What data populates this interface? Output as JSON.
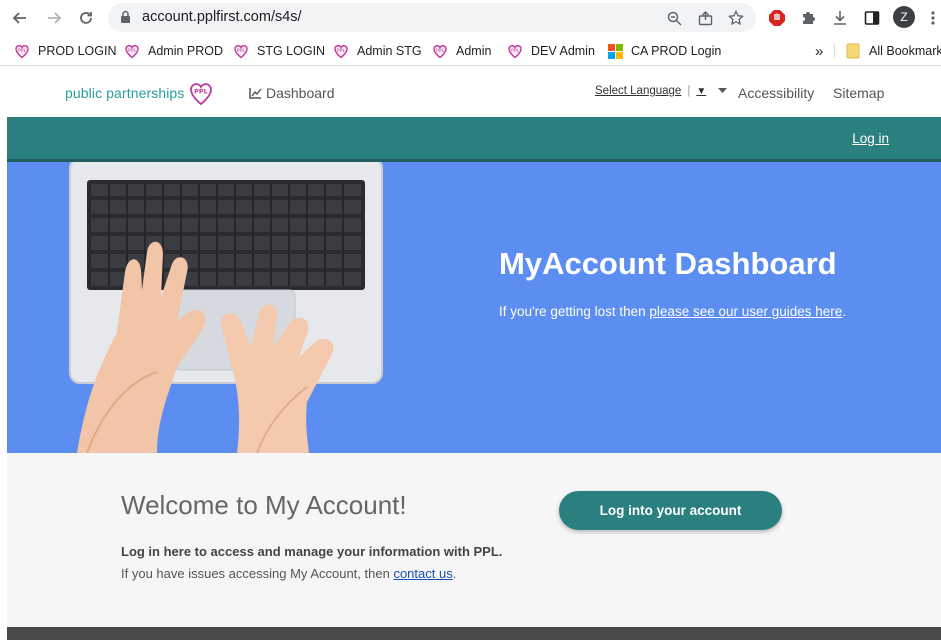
{
  "browser": {
    "url": "account.pplfirst.com/s4s/",
    "avatar_letter": "Z",
    "bookmarks": [
      {
        "label": "PROD LOGIN",
        "icon": "ppl-heart-icon"
      },
      {
        "label": "Admin PROD",
        "icon": "ppl-heart-icon"
      },
      {
        "label": "STG LOGIN",
        "icon": "ppl-heart-icon"
      },
      {
        "label": "Admin STG",
        "icon": "ppl-heart-icon"
      },
      {
        "label": "Admin",
        "icon": "ppl-heart-icon"
      },
      {
        "label": "DEV Admin",
        "icon": "ppl-heart-icon"
      },
      {
        "label": "CA PROD Login",
        "icon": "microsoft-icon"
      }
    ],
    "overflow_label": "»",
    "all_bookmarks_label": "All Bookmarks"
  },
  "header": {
    "logo_text": "public partnerships",
    "logo_badge": "PPL",
    "dashboard_label": "Dashboard",
    "language_label": "Select Language",
    "language_arrow": "▼",
    "accessibility_label": "Accessibility",
    "sitemap_label": "Sitemap"
  },
  "topbar": {
    "login_label": "Log in"
  },
  "hero": {
    "title": "MyAccount Dashboard",
    "sub_prefix": "If you're getting lost then ",
    "sub_link": "please see our user guides here",
    "sub_suffix": "."
  },
  "welcome": {
    "title": "Welcome to My Account!",
    "strong_text": "Log in here to access and manage your information with PPL.",
    "issue_prefix": "If you have issues accessing My Account, then ",
    "issue_link": "contact us",
    "issue_suffix": ".",
    "button_label": "Log into your account"
  },
  "colors": {
    "teal": "#2a7f7f",
    "hero_blue": "#5b8ef0",
    "logo_magenta": "#c0399b",
    "logo_teal": "#2a9d9d"
  }
}
